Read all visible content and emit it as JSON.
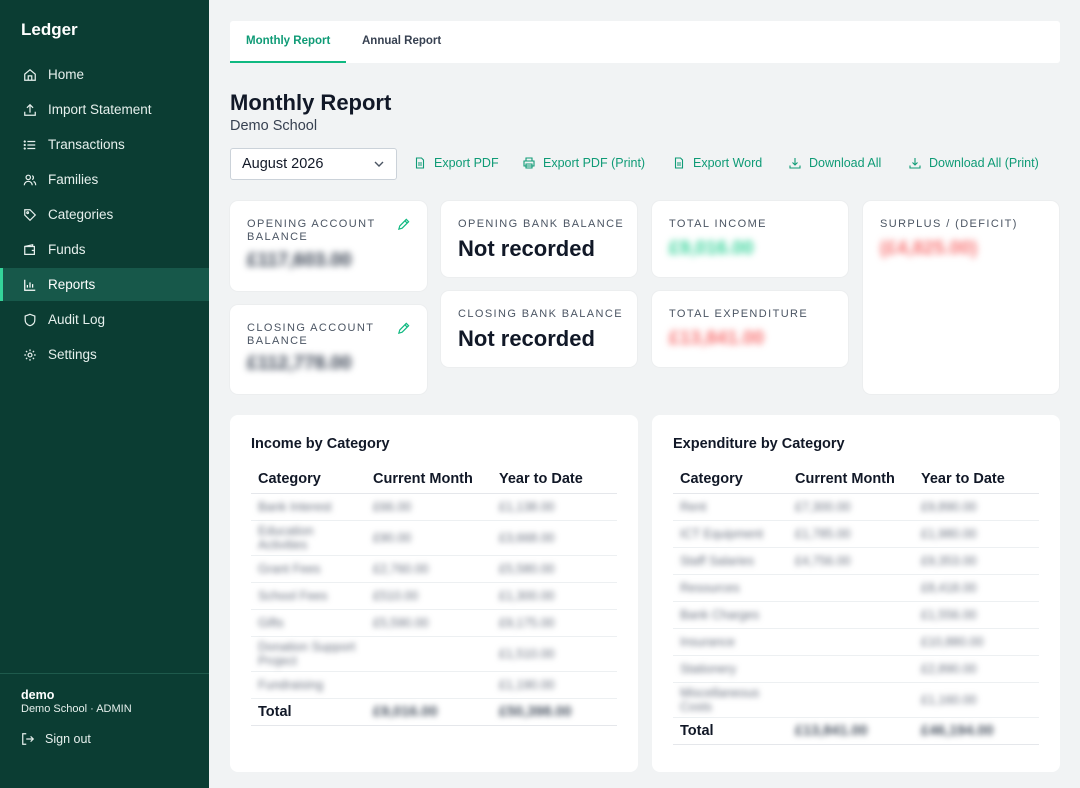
{
  "app": {
    "title": "Ledger"
  },
  "sidebar": {
    "items": [
      {
        "label": "Home",
        "icon": "home-icon"
      },
      {
        "label": "Import Statement",
        "icon": "upload-icon"
      },
      {
        "label": "Transactions",
        "icon": "list-icon"
      },
      {
        "label": "Families",
        "icon": "users-icon"
      },
      {
        "label": "Categories",
        "icon": "tag-icon"
      },
      {
        "label": "Funds",
        "icon": "wallet-icon"
      },
      {
        "label": "Reports",
        "icon": "bar-chart-icon",
        "active": true
      },
      {
        "label": "Audit Log",
        "icon": "shield-icon"
      },
      {
        "label": "Settings",
        "icon": "gear-icon"
      }
    ],
    "user": {
      "name": "demo",
      "org": "Demo School · ADMIN"
    },
    "signout": "Sign out"
  },
  "tabs": [
    {
      "label": "Monthly Report",
      "active": true
    },
    {
      "label": "Annual Report",
      "active": false
    }
  ],
  "header": {
    "title": "Monthly Report",
    "subtitle": "Demo School",
    "month": "August 2026"
  },
  "actions": {
    "export_pdf": "Export PDF",
    "export_pdf_print": "Export PDF (Print)",
    "export_word": "Export Word",
    "download_all": "Download All",
    "download_all_print": "Download All (Print)"
  },
  "cards": {
    "opening_account": {
      "label": "Opening Account Balance",
      "value": "£117,603.00"
    },
    "closing_account": {
      "label": "Closing Account Balance",
      "value": "£112,778.00"
    },
    "opening_bank": {
      "label": "Opening Bank Balance",
      "value": "Not recorded"
    },
    "closing_bank": {
      "label": "Closing Bank Balance",
      "value": "Not recorded"
    },
    "total_income": {
      "label": "Total Income",
      "value": "£9,016.00"
    },
    "total_expenditure": {
      "label": "Total Expenditure",
      "value": "£13,841.00"
    },
    "surplus": {
      "label": "Surplus / (Deficit)",
      "value": "(£4,825.00)"
    }
  },
  "income": {
    "title": "Income by Category",
    "headers": [
      "Category",
      "Current Month",
      "Year to Date"
    ],
    "rows": [
      [
        "Bank Interest",
        "£66.00",
        "£1,138.00"
      ],
      [
        "Education Activities",
        "£90.00",
        "£3,668.00"
      ],
      [
        "Grant Fees",
        "£2,760.00",
        "£5,580.00"
      ],
      [
        "School Fees",
        "£510.00",
        "£1,300.00"
      ],
      [
        "Gifts",
        "£5,590.00",
        "£9,175.00"
      ],
      [
        "Donation Support Project",
        "",
        "£1,510.00"
      ],
      [
        "Fundraising",
        "",
        "£1,190.00"
      ]
    ],
    "total": [
      "Total",
      "£9,016.00",
      "£50,398.00"
    ]
  },
  "expenditure": {
    "title": "Expenditure by Category",
    "headers": [
      "Category",
      "Current Month",
      "Year to Date"
    ],
    "rows": [
      [
        "Rent",
        "£7,300.00",
        "£9,890.00"
      ],
      [
        "ICT Equipment",
        "£1,785.00",
        "£1,980.00"
      ],
      [
        "Staff Salaries",
        "£4,756.00",
        "£9,353.00"
      ],
      [
        "Resources",
        "",
        "£8,418.00"
      ],
      [
        "Bank Charges",
        "",
        "£1,556.00"
      ],
      [
        "Insurance",
        "",
        "£10,880.00"
      ],
      [
        "Stationery",
        "",
        "£2,890.00"
      ],
      [
        "Miscellaneous Costs",
        "",
        "£1,160.00"
      ]
    ],
    "total": [
      "Total",
      "£13,841.00",
      "£46,194.00"
    ]
  }
}
